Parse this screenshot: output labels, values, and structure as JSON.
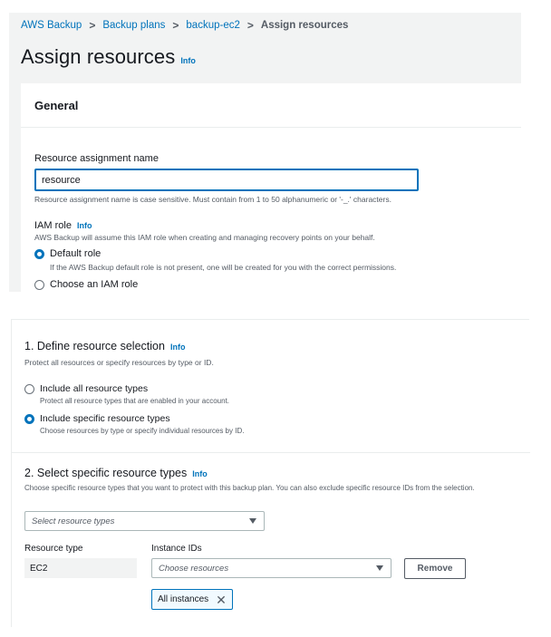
{
  "breadcrumb": {
    "items": [
      "AWS Backup",
      "Backup plans",
      "backup-ec2"
    ],
    "current": "Assign resources",
    "separator": ">"
  },
  "page": {
    "title": "Assign resources",
    "info": "Info"
  },
  "general": {
    "title": "General",
    "name_label": "Resource assignment name",
    "name_value": "resource",
    "name_hint": "Resource assignment name is case sensitive. Must contain from 1 to 50 alphanumeric or '-_.' characters.",
    "iam_label": "IAM role",
    "iam_info": "Info",
    "iam_desc": "AWS Backup will assume this IAM role when creating and managing recovery points on your behalf.",
    "options": [
      {
        "label": "Default role",
        "desc": "If the AWS Backup default role is not present, one will be created for you with the correct permissions.",
        "selected": true
      },
      {
        "label": "Choose an IAM role",
        "selected": false
      }
    ]
  },
  "section1": {
    "title": "1. Define resource selection",
    "info": "Info",
    "desc": "Protect all resources or specify resources by type or ID.",
    "options": [
      {
        "label": "Include all resource types",
        "desc": "Protect all resource types that are enabled in your account.",
        "selected": false
      },
      {
        "label": "Include specific resource types",
        "desc": "Choose resources by type or specify individual resources by ID.",
        "selected": true
      }
    ]
  },
  "section2": {
    "title": "2. Select specific resource types",
    "info": "Info",
    "desc": "Choose specific resource types that you want to protect with this backup plan. You can also exclude specific resource IDs from the selection.",
    "select_placeholder": "Select resource types",
    "col_resource_type": "Resource type",
    "col_instance_ids": "Instance IDs",
    "resource_type_value": "EC2",
    "instance_placeholder": "Choose resources",
    "remove_label": "Remove",
    "token_label": "All instances",
    "token_close": "✕"
  },
  "colors": {
    "accent": "#0073bb",
    "panel": "#f2f3f3",
    "text": "#16191f",
    "muted": "#545b64"
  }
}
